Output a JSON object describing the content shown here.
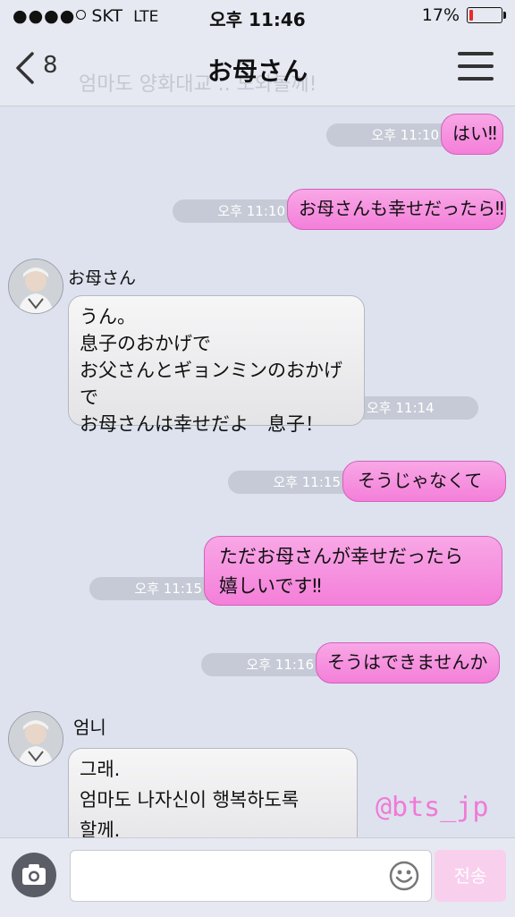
{
  "status_bar": {
    "carrier": "SKT",
    "network": "LTE",
    "time": "오후 11:46",
    "battery": "17%",
    "battery_level": 0.17
  },
  "header": {
    "back_count": "8",
    "title": "お母さん",
    "ghost_text": "엄마도 양화대교 .. 도와볼께!"
  },
  "messages": [
    {
      "dir": "out",
      "time": "오후 11:10",
      "lines": [
        "はい‼︎"
      ]
    },
    {
      "dir": "out",
      "time": "오후 11:10",
      "lines": [
        "お母さんも幸せだったら‼︎"
      ]
    },
    {
      "dir": "in",
      "sender": "お母さん",
      "time": "오후 11:14",
      "lines": [
        "うん。",
        "息子のおかげで",
        "お父さんとギョンミンのおかげで",
        "お母さんは幸せだよ　息子！"
      ]
    },
    {
      "dir": "out",
      "time": "오후 11:15",
      "lines": [
        "そうじゃなくて"
      ]
    },
    {
      "dir": "out",
      "time": "오후 11:15",
      "lines": [
        "ただお母さんが幸せだったら",
        "嬉しいです‼︎"
      ]
    },
    {
      "dir": "out",
      "time": "오후 11:16",
      "lines": [
        "そうはできませんか"
      ]
    },
    {
      "dir": "in",
      "sender": "엄니",
      "lines": [
        "그래.",
        "엄마도 나자신이 행복하도록",
        "할께."
      ]
    }
  ],
  "input_bar": {
    "send_label": "전송",
    "camera_icon": "camera-icon",
    "emoji_icon": "emoji-icon"
  },
  "watermark": "@bts_jp",
  "colors": {
    "background": "#dde2ee",
    "outgoing_bubble": "#f47fd9",
    "incoming_bubble": "#ececee",
    "send_button": "#f9cfee"
  }
}
